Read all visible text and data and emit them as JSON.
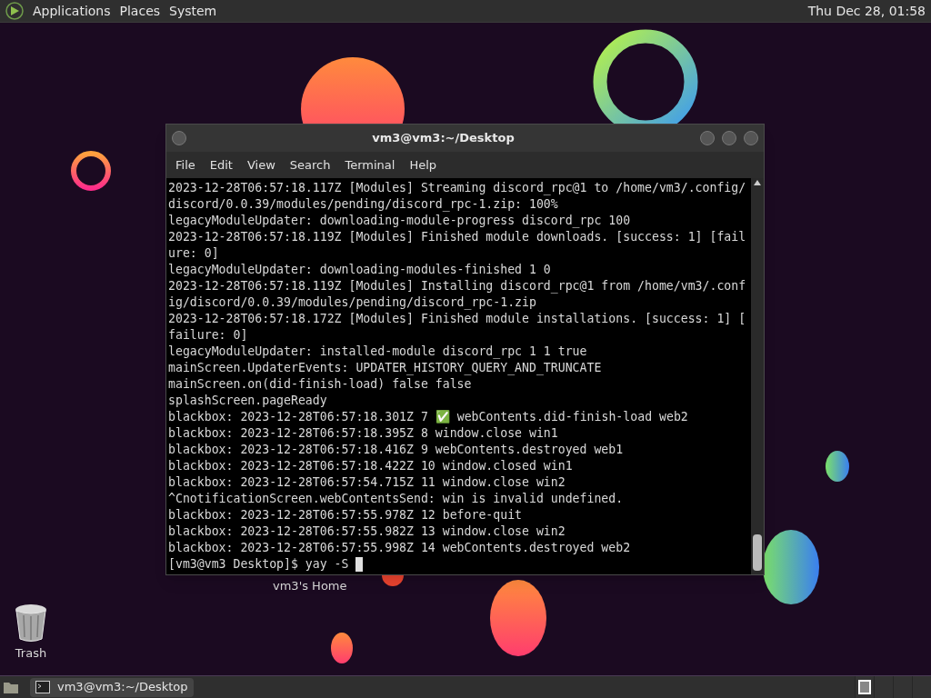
{
  "top_panel": {
    "menus": [
      "Applications",
      "Places",
      "System"
    ],
    "clock": "Thu Dec 28, 01:58"
  },
  "desktop_icons": [
    {
      "kind": "home",
      "label": "vm3's Home"
    },
    {
      "kind": "trash",
      "label": "Trash"
    }
  ],
  "terminal": {
    "title": "vm3@vm3:~/Desktop",
    "menu": [
      "File",
      "Edit",
      "View",
      "Search",
      "Terminal",
      "Help"
    ],
    "lines": [
      "2023-12-28T06:57:18.117Z [Modules] Streaming discord_rpc@1 to /home/vm3/.config/",
      "discord/0.0.39/modules/pending/discord_rpc-1.zip: 100%",
      "legacyModuleUpdater: downloading-module-progress discord_rpc 100",
      "2023-12-28T06:57:18.119Z [Modules] Finished module downloads. [success: 1] [fail",
      "ure: 0]",
      "legacyModuleUpdater: downloading-modules-finished 1 0",
      "2023-12-28T06:57:18.119Z [Modules] Installing discord_rpc@1 from /home/vm3/.conf",
      "ig/discord/0.0.39/modules/pending/discord_rpc-1.zip",
      "2023-12-28T06:57:18.172Z [Modules] Finished module installations. [success: 1] [",
      "failure: 0]",
      "legacyModuleUpdater: installed-module discord_rpc 1 1 true",
      "mainScreen.UpdaterEvents: UPDATER_HISTORY_QUERY_AND_TRUNCATE",
      "mainScreen.on(did-finish-load) false false",
      "splashScreen.pageReady",
      "blackbox: 2023-12-28T06:57:18.301Z 7 ✅ webContents.did-finish-load web2",
      "blackbox: 2023-12-28T06:57:18.395Z 8 window.close win1",
      "blackbox: 2023-12-28T06:57:18.416Z 9 webContents.destroyed web1",
      "blackbox: 2023-12-28T06:57:18.422Z 10 window.closed win1",
      "blackbox: 2023-12-28T06:57:54.715Z 11 window.close win2",
      "^CnotificationScreen.webContentsSend: win is invalid undefined.",
      "blackbox: 2023-12-28T06:57:55.978Z 12 before-quit",
      "blackbox: 2023-12-28T06:57:55.982Z 13 window.close win2",
      "blackbox: 2023-12-28T06:57:55.998Z 14 webContents.destroyed web2"
    ],
    "prompt": "[vm3@vm3 Desktop]$ yay -S "
  },
  "taskbar": {
    "tasks": [
      {
        "label": "vm3@vm3:~/Desktop",
        "selected": false
      }
    ],
    "workspaces": [
      {
        "selected": true
      },
      {
        "selected": false
      },
      {
        "selected": false
      },
      {
        "selected": false
      }
    ]
  }
}
